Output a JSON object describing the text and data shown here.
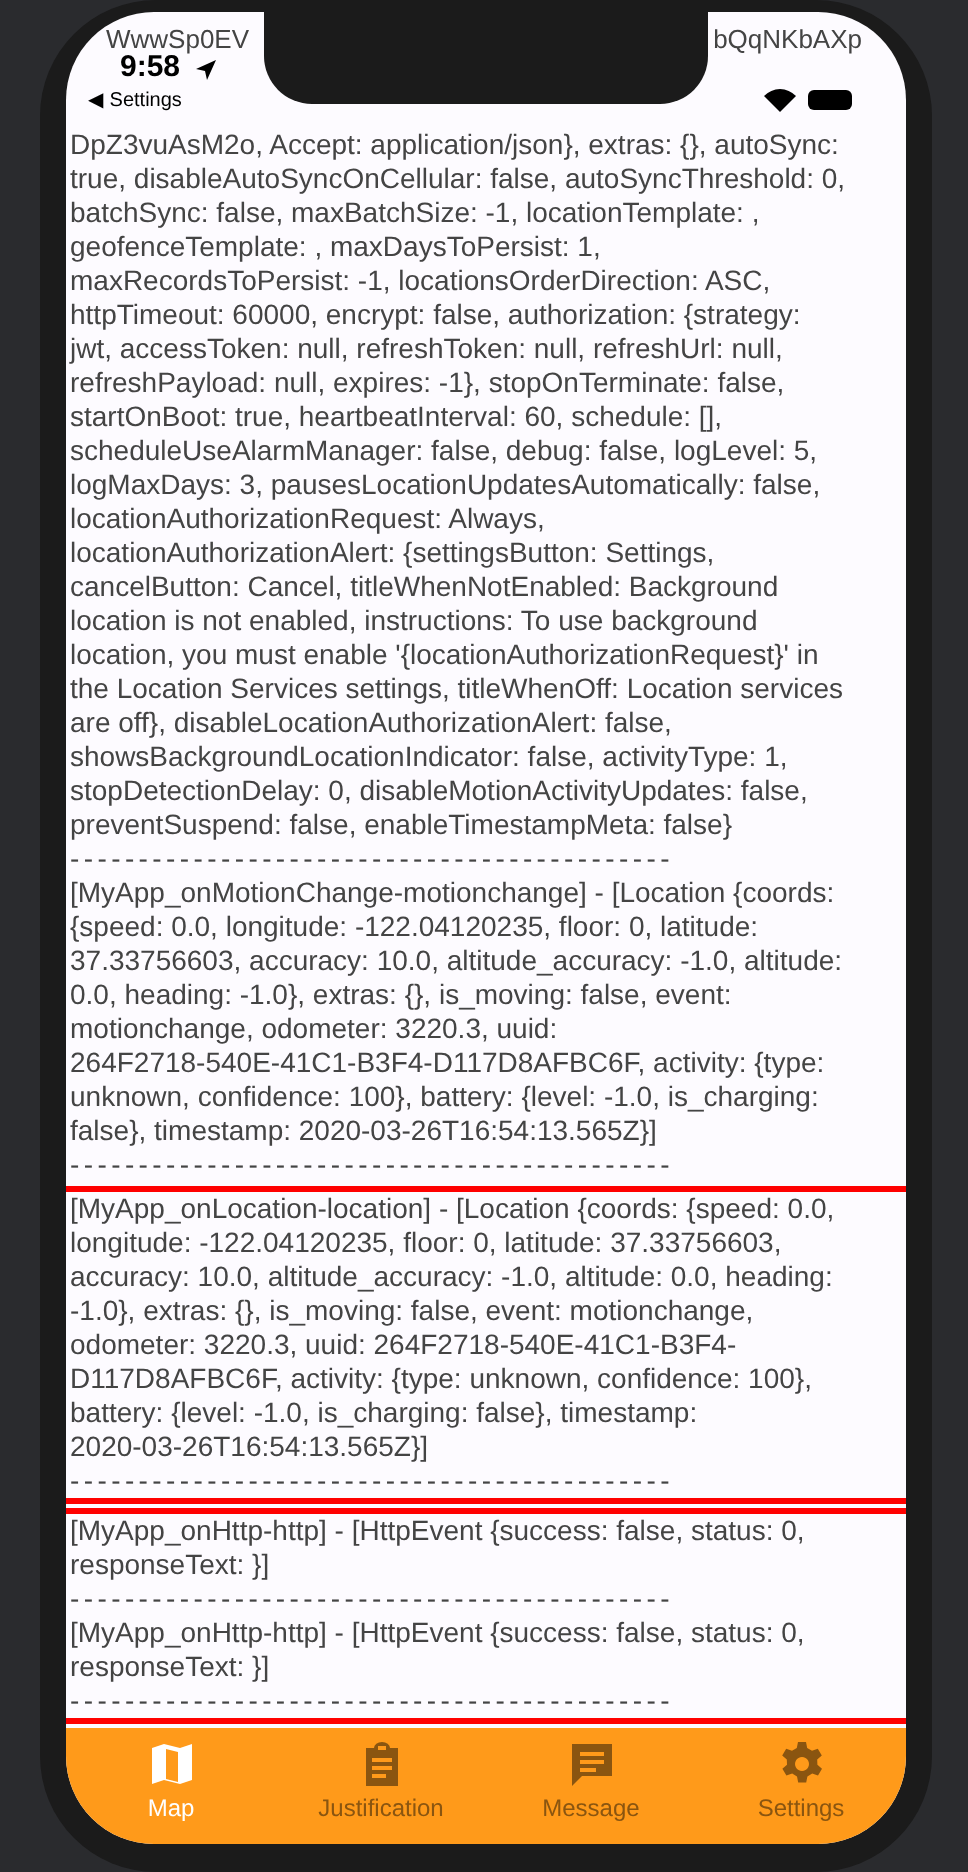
{
  "top_fragments": {
    "left": "WwwSp0EV",
    "right": "bQqNKbAXp"
  },
  "status_bar": {
    "time": "9:58",
    "back_label": "◀ Settings"
  },
  "log_blocks": [
    {
      "highlighted": false,
      "entries": [
        {
          "lines": [
            "DpZ3vuAsM2o, Accept: application/json}, extras: {}, autoSync:",
            "true, disableAutoSyncOnCellular: false, autoSyncThreshold: 0,",
            "batchSync: false, maxBatchSize: -1, locationTemplate: ,",
            "geofenceTemplate: , maxDaysToPersist: 1,",
            "maxRecordsToPersist: -1, locationsOrderDirection: ASC,",
            "httpTimeout: 60000, encrypt: false, authorization: {strategy:",
            "jwt, accessToken: null, refreshToken: null, refreshUrl: null,",
            "refreshPayload: null, expires: -1}, stopOnTerminate: false,",
            "startOnBoot: true, heartbeatInterval: 60, schedule: [],",
            "scheduleUseAlarmManager: false, debug: false, logLevel: 5,",
            "logMaxDays: 3, pausesLocationUpdatesAutomatically: false,",
            "locationAuthorizationRequest: Always,",
            "locationAuthorizationAlert: {settingsButton: Settings,",
            "cancelButton: Cancel, titleWhenNotEnabled: Background",
            "location is not enabled, instructions: To use background",
            "location, you must enable '{locationAuthorizationRequest}' in",
            "the Location Services settings, titleWhenOff: Location services",
            "are off}, disableLocationAuthorizationAlert: false,",
            "showsBackgroundLocationIndicator: false, activityType: 1,",
            "stopDetectionDelay: 0, disableMotionActivityUpdates: false,",
            "preventSuspend: false, enableTimestampMeta: false}"
          ],
          "separator": "--------------------------------------------"
        },
        {
          "lines": [
            "[MyApp_onMotionChange-motionchange] - [Location {coords:",
            "{speed: 0.0, longitude: -122.04120235, floor: 0, latitude:",
            "37.33756603, accuracy: 10.0, altitude_accuracy: -1.0, altitude:",
            "0.0, heading: -1.0}, extras: {}, is_moving: false, event:",
            "motionchange, odometer: 3220.3, uuid:",
            "264F2718-540E-41C1-B3F4-D117D8AFBC6F, activity: {type:",
            "unknown, confidence: 100}, battery: {level: -1.0, is_charging:",
            "false}, timestamp: 2020-03-26T16:54:13.565Z}]"
          ],
          "separator": "--------------------------------------------"
        }
      ]
    },
    {
      "highlighted": true,
      "entries": [
        {
          "lines": [
            "[MyApp_onLocation-location] - [Location {coords: {speed: 0.0,",
            "longitude: -122.04120235, floor: 0, latitude: 37.33756603,",
            "accuracy: 10.0, altitude_accuracy: -1.0, altitude: 0.0, heading:",
            "-1.0}, extras: {}, is_moving: false, event: motionchange,",
            "odometer: 3220.3, uuid: 264F2718-540E-41C1-B3F4-",
            "D117D8AFBC6F, activity: {type: unknown, confidence: 100},",
            "battery: {level: -1.0, is_charging: false}, timestamp:",
            "2020-03-26T16:54:13.565Z}]"
          ],
          "separator": "--------------------------------------------"
        }
      ]
    },
    {
      "highlighted": true,
      "entries": [
        {
          "lines": [
            "[MyApp_onHttp-http] - [HttpEvent {success: false, status: 0,",
            "responseText: }]"
          ],
          "separator": "--------------------------------------------"
        },
        {
          "lines": [
            "[MyApp_onHttp-http] - [HttpEvent {success: false, status: 0,",
            "responseText: }]"
          ],
          "separator": "--------------------------------------------"
        }
      ]
    }
  ],
  "tabs": [
    {
      "kind": "map",
      "label": "Map",
      "selected": true
    },
    {
      "kind": "clipboard",
      "label": "Justification",
      "selected": false
    },
    {
      "kind": "message",
      "label": "Message",
      "selected": false
    },
    {
      "kind": "settings",
      "label": "Settings",
      "selected": false
    }
  ]
}
